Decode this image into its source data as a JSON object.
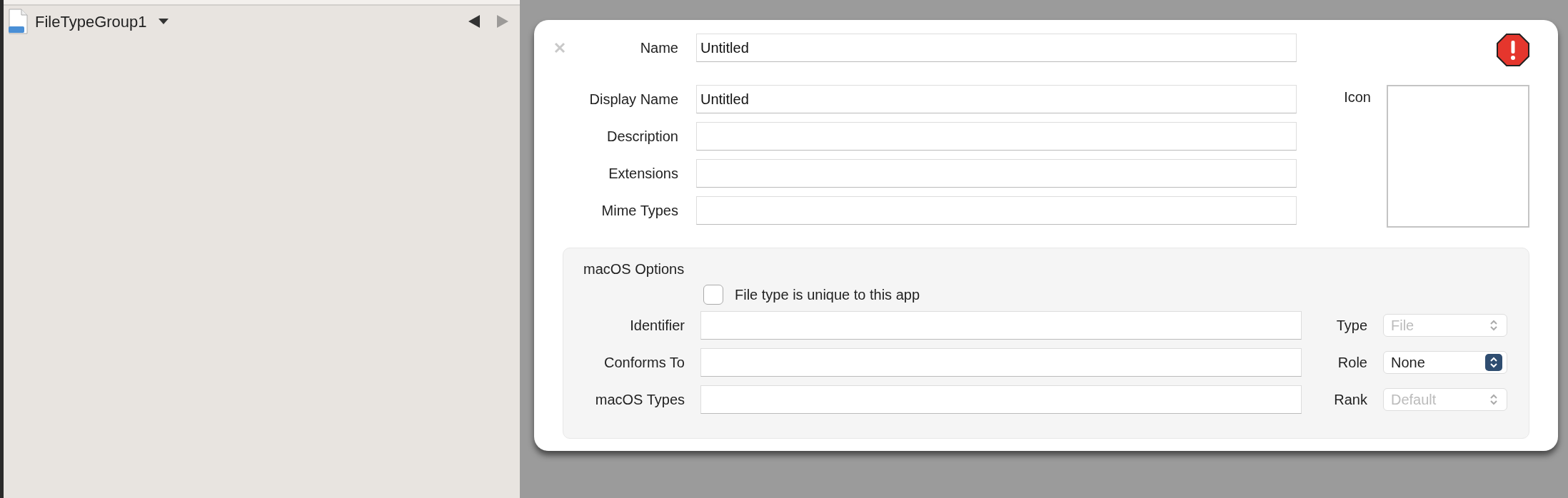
{
  "sidebar": {
    "title": "FileTypeGroup1",
    "nav_buttons": [
      {
        "kind": "back",
        "disabled": false
      },
      {
        "kind": "forward",
        "disabled": true
      }
    ]
  },
  "dialog": {
    "fields": [
      {
        "label": "Name",
        "value": "Untitled"
      },
      {
        "label": "Display Name",
        "value": "Untitled"
      },
      {
        "label": "Description"
      },
      {
        "label": "Extensions"
      },
      {
        "label": "Mime Types"
      }
    ],
    "icon_label": "Icon",
    "macos_options": {
      "title": "macOS Options",
      "checkbox": {
        "label": "File type is unique to this app",
        "checked": false
      },
      "rows": [
        {
          "label": "Identifier",
          "select_label": "Type",
          "select_value": "File",
          "select_disabled": true
        },
        {
          "label": "Conforms To",
          "select_label": "Role",
          "select_value": "None",
          "select_disabled": false
        },
        {
          "label": "macOS Types",
          "select_label": "Rank",
          "select_value": "Default",
          "select_disabled": true
        }
      ]
    }
  }
}
